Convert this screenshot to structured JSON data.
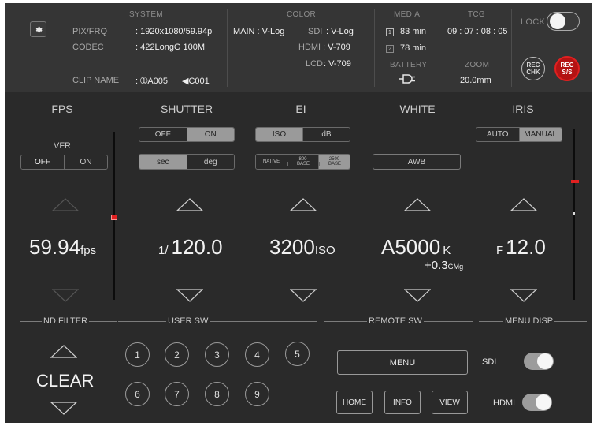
{
  "system": {
    "header": "SYSTEM",
    "pixfrq_label": "PIX/FRQ",
    "pixfrq_value": ": 1920x1080/59.94p",
    "codec_label": "CODEC",
    "codec_value": ": 422LongG 100M",
    "clipname_label": "CLIP NAME",
    "clip_a": ": ➀A005",
    "clip_b": "◀C001"
  },
  "color": {
    "header": "COLOR",
    "main": "MAIN : V-Log",
    "sdi_label": "SDI",
    "sdi_value": ": V-Log",
    "hdmi_label": "HDMI",
    "hdmi_value": ": V-709",
    "lcd_label": "LCD",
    "lcd_value": ": V-709"
  },
  "media": {
    "header": "MEDIA",
    "slot1_badge": "1",
    "slot1": "83 min",
    "slot2_badge": "2",
    "slot2": "78 min",
    "battery_label": "BATTERY"
  },
  "tcg": {
    "header": "TCG",
    "value": "09 : 07 : 08 : 05",
    "zoom_label": "ZOOM",
    "zoom_value": "20.0mm"
  },
  "lock": {
    "label": "LOCK",
    "on": true
  },
  "rec_chk": {
    "line1": "REC",
    "line2": "CHK"
  },
  "rec_ss": {
    "line1": "REC",
    "line2": "S/S",
    "color": "#b31313"
  },
  "fps": {
    "header": "FPS",
    "vfr_label": "VFR",
    "off": "OFF",
    "on": "ON",
    "value": "59.94",
    "unit": "fps"
  },
  "shutter": {
    "header": "SHUTTER",
    "off": "OFF",
    "on": "ON",
    "sec": "sec",
    "deg": "deg",
    "prefix": "1/",
    "value": "120.0"
  },
  "ei": {
    "header": "EI",
    "iso": "ISO",
    "db": "dB",
    "native": "NATIVE",
    "base800_top": "800",
    "base800_bot": "BASE",
    "base2500_top": "2500",
    "base2500_bot": "BASE",
    "value": "3200",
    "unit": "ISO"
  },
  "white": {
    "header": "WHITE",
    "awb": "AWB",
    "value": "A5000",
    "unit": "K",
    "gmg_value": "+0.3",
    "gmg_unit": "GMg"
  },
  "iris": {
    "header": "IRIS",
    "auto": "AUTO",
    "manual": "MANUAL",
    "prefix": "F",
    "value": "12.0"
  },
  "sections": {
    "nd": "ND FILTER",
    "user": "USER SW",
    "remote": "REMOTE SW",
    "menu": "MENU DISP"
  },
  "nd": {
    "value": "CLEAR"
  },
  "user_sw": [
    "1",
    "2",
    "3",
    "4",
    "5",
    "6",
    "7",
    "8",
    "9"
  ],
  "remote": {
    "menu": "MENU",
    "home": "HOME",
    "info": "INFO",
    "view": "VIEW"
  },
  "menu_disp": {
    "sdi": "SDI",
    "hdmi": "HDMI",
    "sdi_on": true,
    "hdmi_on": true
  },
  "colors": {
    "accent_red": "#e02020",
    "toggle_on": "#9c9c9c"
  }
}
